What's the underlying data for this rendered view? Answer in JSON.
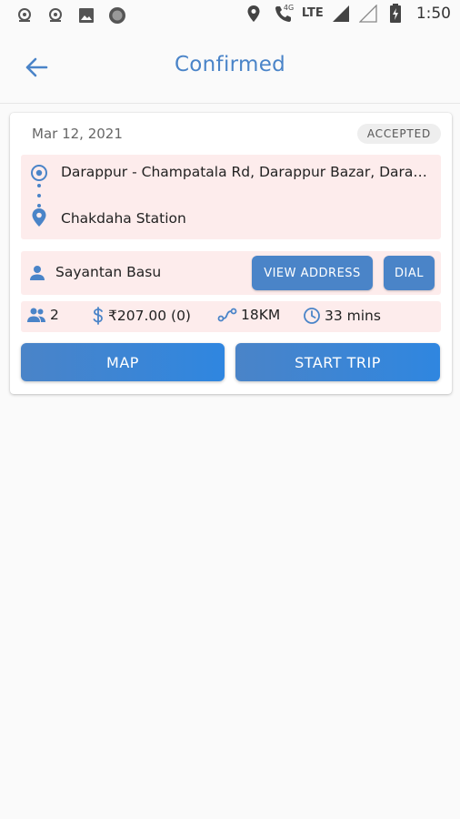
{
  "status_bar": {
    "time": "1:50",
    "network_label": "LTE",
    "call_label": "4G",
    "icons": [
      "notification-icon",
      "notification-icon",
      "image-icon",
      "record-icon",
      "location-icon",
      "wifi-call-icon",
      "signal-icon",
      "signal-empty-icon",
      "battery-icon"
    ]
  },
  "header": {
    "title": "Confirmed"
  },
  "trip": {
    "date": "Mar 12, 2021",
    "status": "ACCEPTED",
    "pickup": "Darappur - Champatala Rd, Darappur Bazar, Darappur, West Bengal",
    "drop": "Chakdaha Station",
    "customer_name": "Sayantan Basu",
    "view_address_label": "VIEW ADDRESS",
    "dial_label": "DIAL",
    "passengers": "2",
    "fare": "₹207.00 (0)",
    "distance": "18KM",
    "duration": "33 mins",
    "map_label": "MAP",
    "start_trip_label": "START TRIP"
  },
  "colors": {
    "accent": "#4a84c8",
    "panel": "#fdecec",
    "background": "#fafafa"
  }
}
